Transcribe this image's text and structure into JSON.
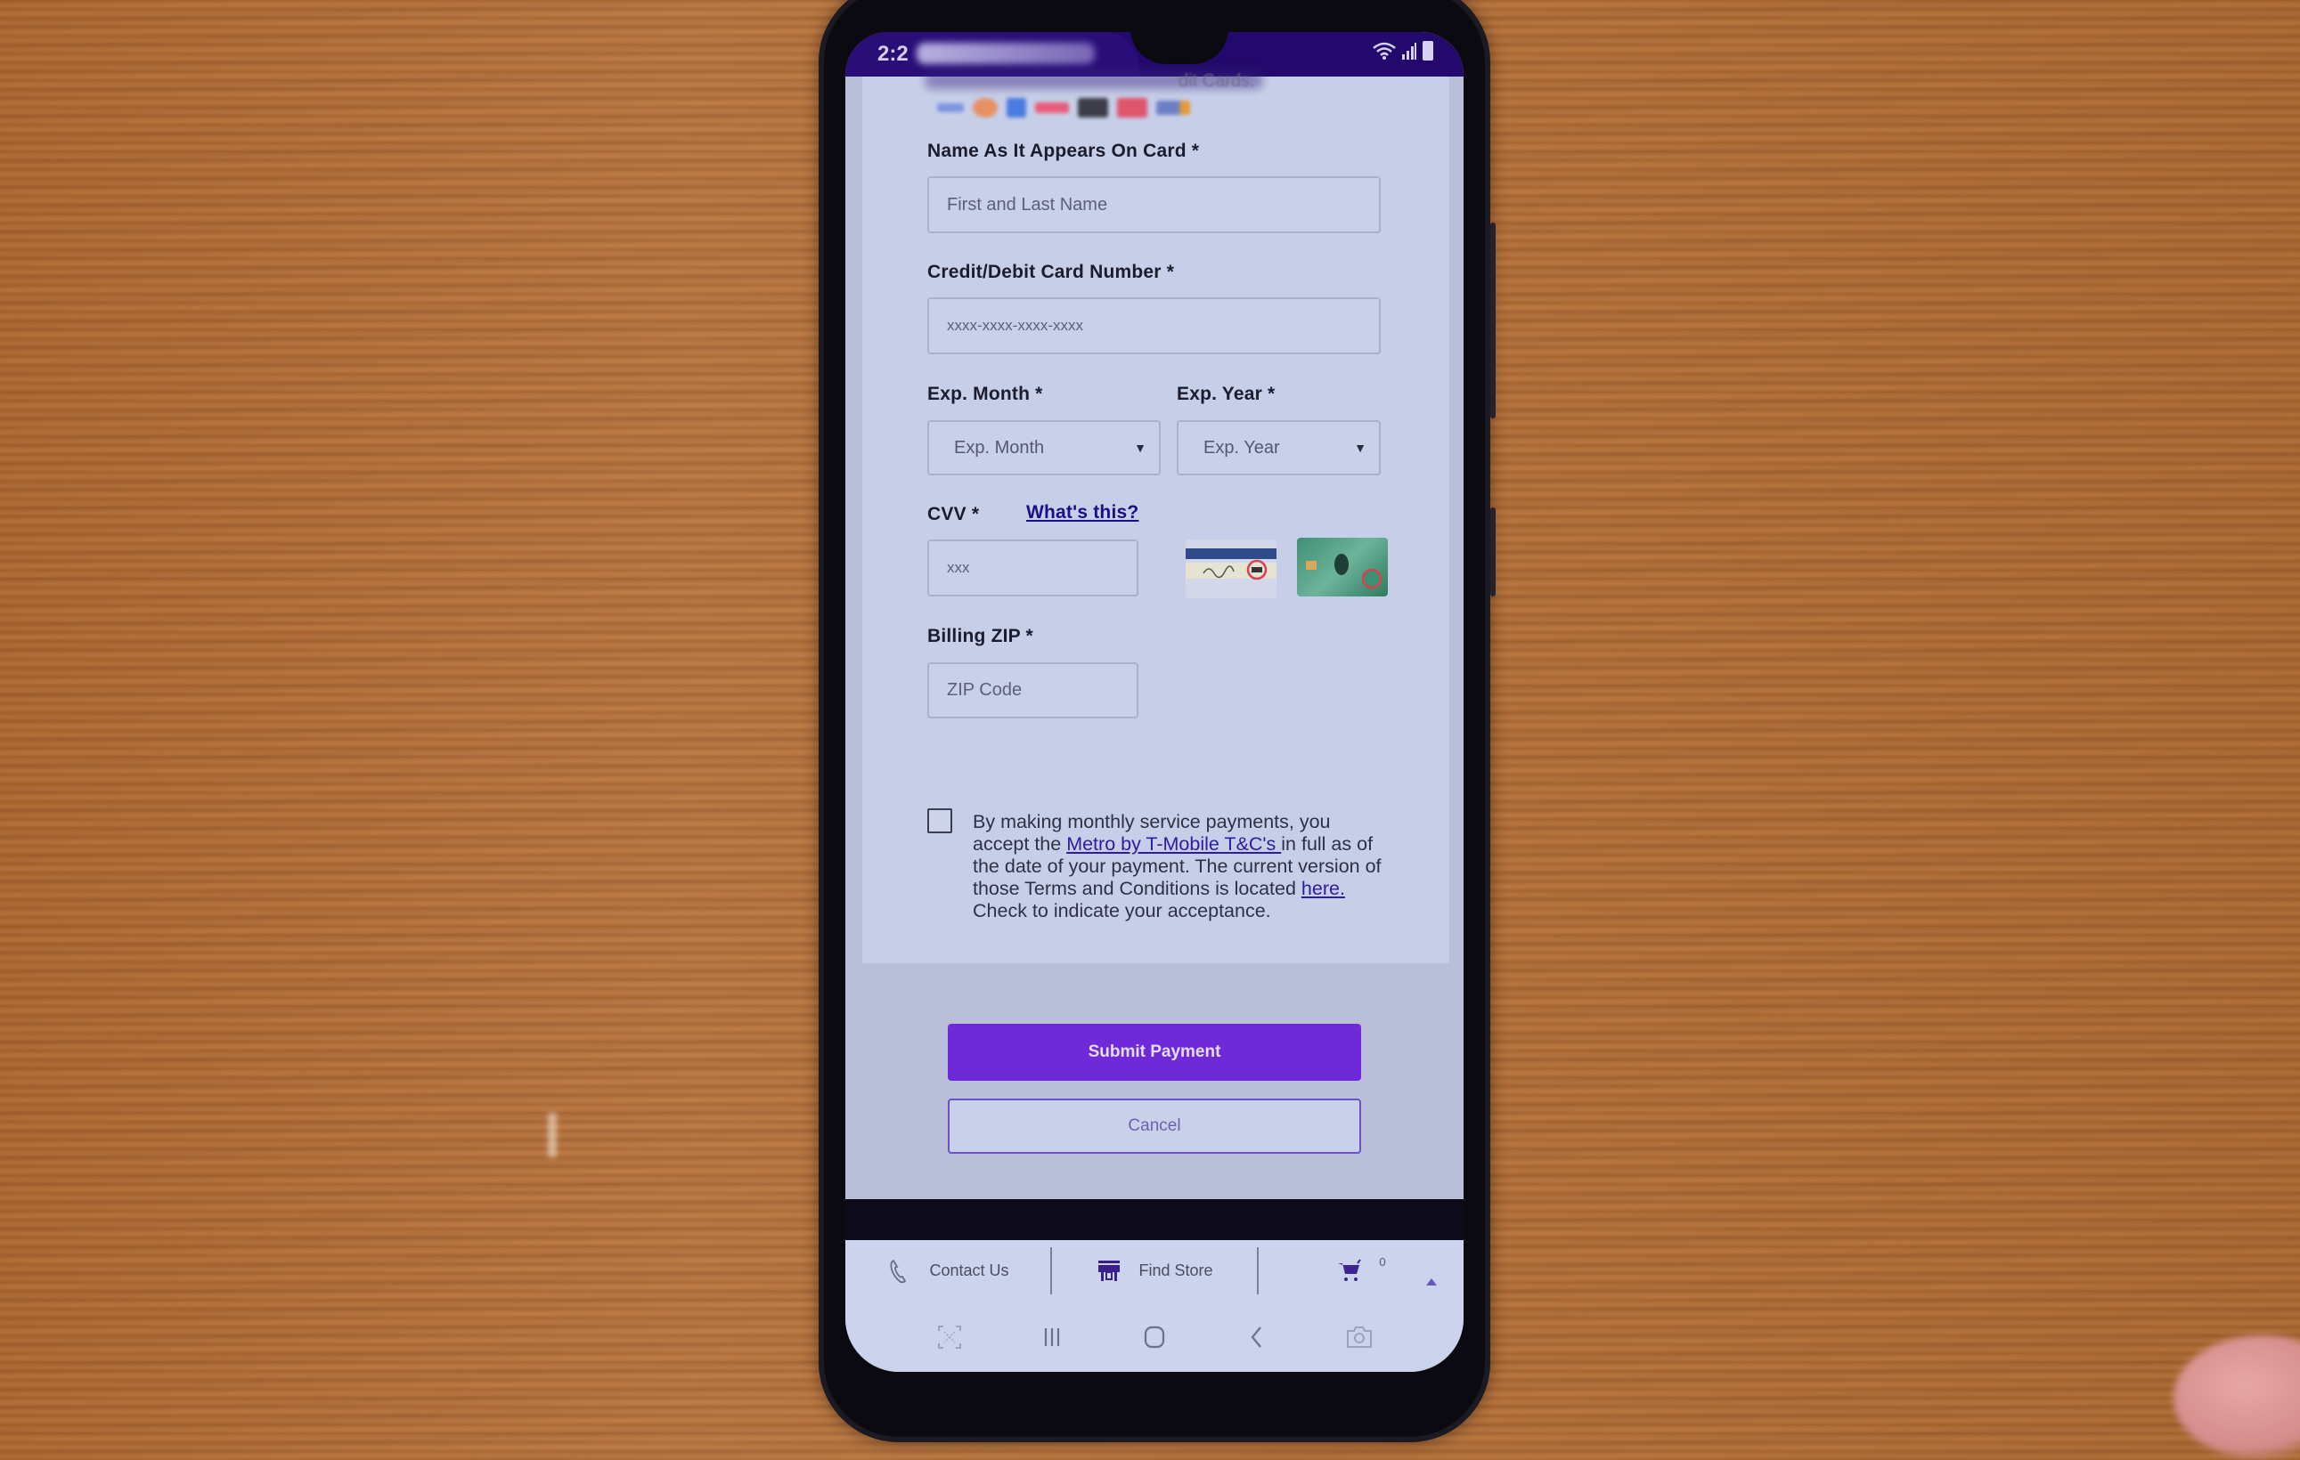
{
  "status_bar": {
    "time": "2:2",
    "icons": [
      "wifi-icon",
      "signal-icon",
      "battery-icon"
    ],
    "color": "#23096b"
  },
  "accepted_cards": {
    "heading_visible_tail": "dit Cards.",
    "logos": [
      "amex-logo",
      "mastercard-logo",
      "discover-logo",
      "visa-logo",
      "pulse-logo",
      "star-logo",
      "accel-logo"
    ]
  },
  "form": {
    "name": {
      "label": "Name As It Appears On Card *",
      "placeholder": "First and Last Name",
      "value": ""
    },
    "card_number": {
      "label": "Credit/Debit Card Number *",
      "placeholder": "xxxx-xxxx-xxxx-xxxx",
      "value": ""
    },
    "exp_month": {
      "label": "Exp. Month *",
      "selected": "Exp. Month"
    },
    "exp_year": {
      "label": "Exp. Year *",
      "selected": "Exp. Year"
    },
    "cvv": {
      "label": "CVV *",
      "help_link": "What's this?",
      "placeholder": "xxx",
      "value": ""
    },
    "zip": {
      "label": "Billing ZIP *",
      "placeholder": "ZIP Code",
      "value": ""
    },
    "terms": {
      "checked": false,
      "text_before": "By making monthly service payments, you accept the ",
      "link_tc": "Metro by T-Mobile T&C's ",
      "text_middle": "in full as of the date of your payment. The current version of those Terms and Conditions is located ",
      "link_here": "here.",
      "text_after": " Check to indicate your acceptance."
    }
  },
  "actions": {
    "submit_label": "Submit Payment",
    "cancel_label": "Cancel"
  },
  "bottom_nav": {
    "contact_label": "Contact Us",
    "store_label": "Find Store",
    "cart_count": "0"
  },
  "system_nav": [
    "screenshot-scan-icon",
    "recents-icon",
    "home-icon",
    "back-icon",
    "camera-icon"
  ],
  "colors": {
    "primary": "#6e2ad8",
    "link": "#1b0e86",
    "form_bg": "#c7cfe8"
  }
}
